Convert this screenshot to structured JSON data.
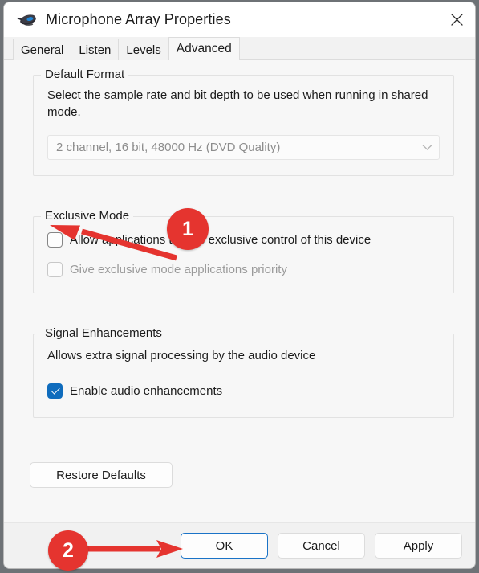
{
  "window": {
    "title": "Microphone Array Properties",
    "icon": "microphone-array-icon",
    "close_icon": "close-icon"
  },
  "tabs": [
    {
      "label": "General",
      "active": false
    },
    {
      "label": "Listen",
      "active": false
    },
    {
      "label": "Levels",
      "active": false
    },
    {
      "label": "Advanced",
      "active": true
    }
  ],
  "groups": {
    "default_format": {
      "title": "Default Format",
      "description": "Select the sample rate and bit depth to be used when running in shared mode.",
      "combo": {
        "value": "2 channel, 16 bit, 48000 Hz (DVD Quality)",
        "enabled": false,
        "chevron_icon": "chevron-down-icon"
      }
    },
    "exclusive_mode": {
      "title": "Exclusive Mode",
      "checkboxes": [
        {
          "label": "Allow applications to take exclusive control of this device",
          "checked": false,
          "enabled": true
        },
        {
          "label": "Give exclusive mode applications priority",
          "checked": false,
          "enabled": false
        }
      ]
    },
    "signal_enhancements": {
      "title": "Signal Enhancements",
      "description": "Allows extra signal processing by the audio device",
      "checkboxes": [
        {
          "label": "Enable audio enhancements",
          "checked": true,
          "enabled": true
        }
      ]
    }
  },
  "buttons": {
    "restore_defaults": "Restore Defaults",
    "ok": "OK",
    "cancel": "Cancel",
    "apply": "Apply"
  },
  "annotations": [
    {
      "number": "1",
      "target": "allow-exclusive-control-checkbox"
    },
    {
      "number": "2",
      "target": "ok-button"
    }
  ],
  "colors": {
    "accent": "#0f6cbd",
    "annotation_red": "#e5342f",
    "focus_border": "#1a73c7",
    "window_bg": "#f7f7f7",
    "titlebar_bg": "#ffffff",
    "footer_bg": "#f1f1f1"
  }
}
